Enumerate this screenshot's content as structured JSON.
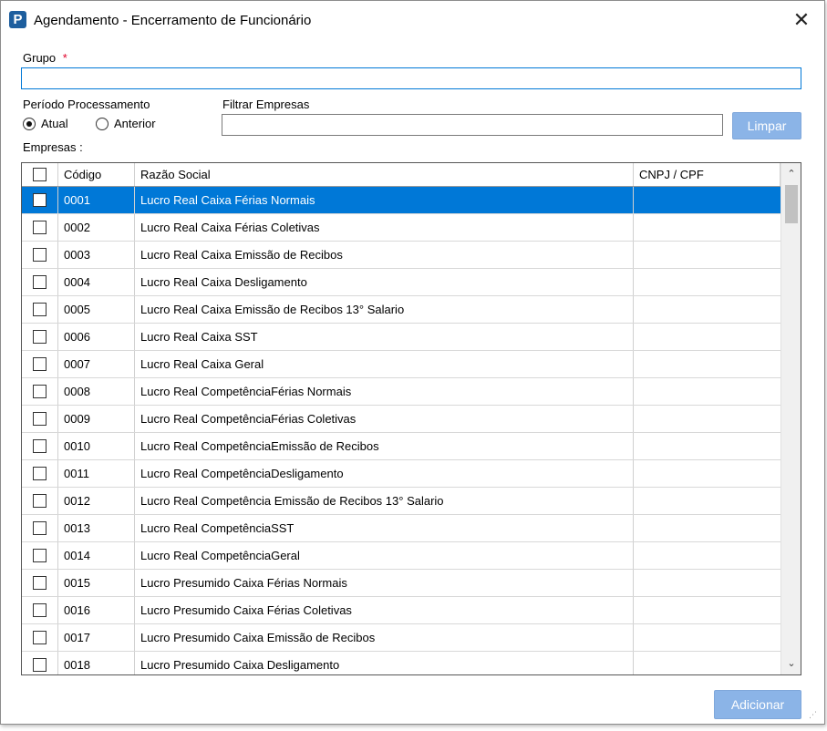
{
  "window": {
    "title": "Agendamento - Encerramento de Funcionário",
    "icon_letter": "P",
    "close_glyph": "✕"
  },
  "grupo": {
    "label": "Grupo",
    "required_marker": "*",
    "value": ""
  },
  "periodo": {
    "label": "Período Processamento",
    "options": [
      {
        "label": "Atual",
        "checked": true
      },
      {
        "label": "Anterior",
        "checked": false
      }
    ]
  },
  "filtro": {
    "label": "Filtrar Empresas",
    "value": "",
    "clear_label": "Limpar"
  },
  "empresas": {
    "label": "Empresas :",
    "columns": [
      "Código",
      "Razão Social",
      "CNPJ / CPF"
    ],
    "selected_index": 0,
    "rows": [
      {
        "code": "0001",
        "name": "Lucro Real Caixa Férias Normais",
        "cnpj": ""
      },
      {
        "code": "0002",
        "name": "Lucro Real Caixa Férias Coletivas",
        "cnpj": ""
      },
      {
        "code": "0003",
        "name": "Lucro Real Caixa Emissão de Recibos",
        "cnpj": ""
      },
      {
        "code": "0004",
        "name": "Lucro Real Caixa Desligamento",
        "cnpj": ""
      },
      {
        "code": "0005",
        "name": "Lucro Real Caixa Emissão de Recibos 13° Salario",
        "cnpj": ""
      },
      {
        "code": "0006",
        "name": "Lucro Real Caixa SST",
        "cnpj": ""
      },
      {
        "code": "0007",
        "name": "Lucro Real Caixa Geral",
        "cnpj": ""
      },
      {
        "code": "0008",
        "name": "Lucro Real CompetênciaFérias Normais",
        "cnpj": ""
      },
      {
        "code": "0009",
        "name": "Lucro Real CompetênciaFérias Coletivas",
        "cnpj": ""
      },
      {
        "code": "0010",
        "name": "Lucro Real CompetênciaEmissão de Recibos",
        "cnpj": ""
      },
      {
        "code": "0011",
        "name": "Lucro Real CompetênciaDesligamento",
        "cnpj": ""
      },
      {
        "code": "0012",
        "name": "Lucro Real Competência Emissão de Recibos 13° Salario",
        "cnpj": ""
      },
      {
        "code": "0013",
        "name": "Lucro Real CompetênciaSST",
        "cnpj": ""
      },
      {
        "code": "0014",
        "name": "Lucro Real CompetênciaGeral",
        "cnpj": ""
      },
      {
        "code": "0015",
        "name": "Lucro Presumido Caixa Férias Normais",
        "cnpj": ""
      },
      {
        "code": "0016",
        "name": "Lucro Presumido Caixa Férias Coletivas",
        "cnpj": ""
      },
      {
        "code": "0017",
        "name": "Lucro Presumido Caixa Emissão de Recibos",
        "cnpj": ""
      },
      {
        "code": "0018",
        "name": "Lucro Presumido Caixa Desligamento",
        "cnpj": ""
      }
    ]
  },
  "footer": {
    "add_label": "Adicionar"
  },
  "colors": {
    "accent": "#0078d7",
    "button": "#8bb4e7",
    "brand_icon": "#1d5e9e",
    "required": "#e0002a"
  },
  "icons": {
    "app": "app-logo-icon",
    "close": "close-icon",
    "scroll_up": "chevron-up-icon",
    "scroll_down": "chevron-down-icon"
  }
}
